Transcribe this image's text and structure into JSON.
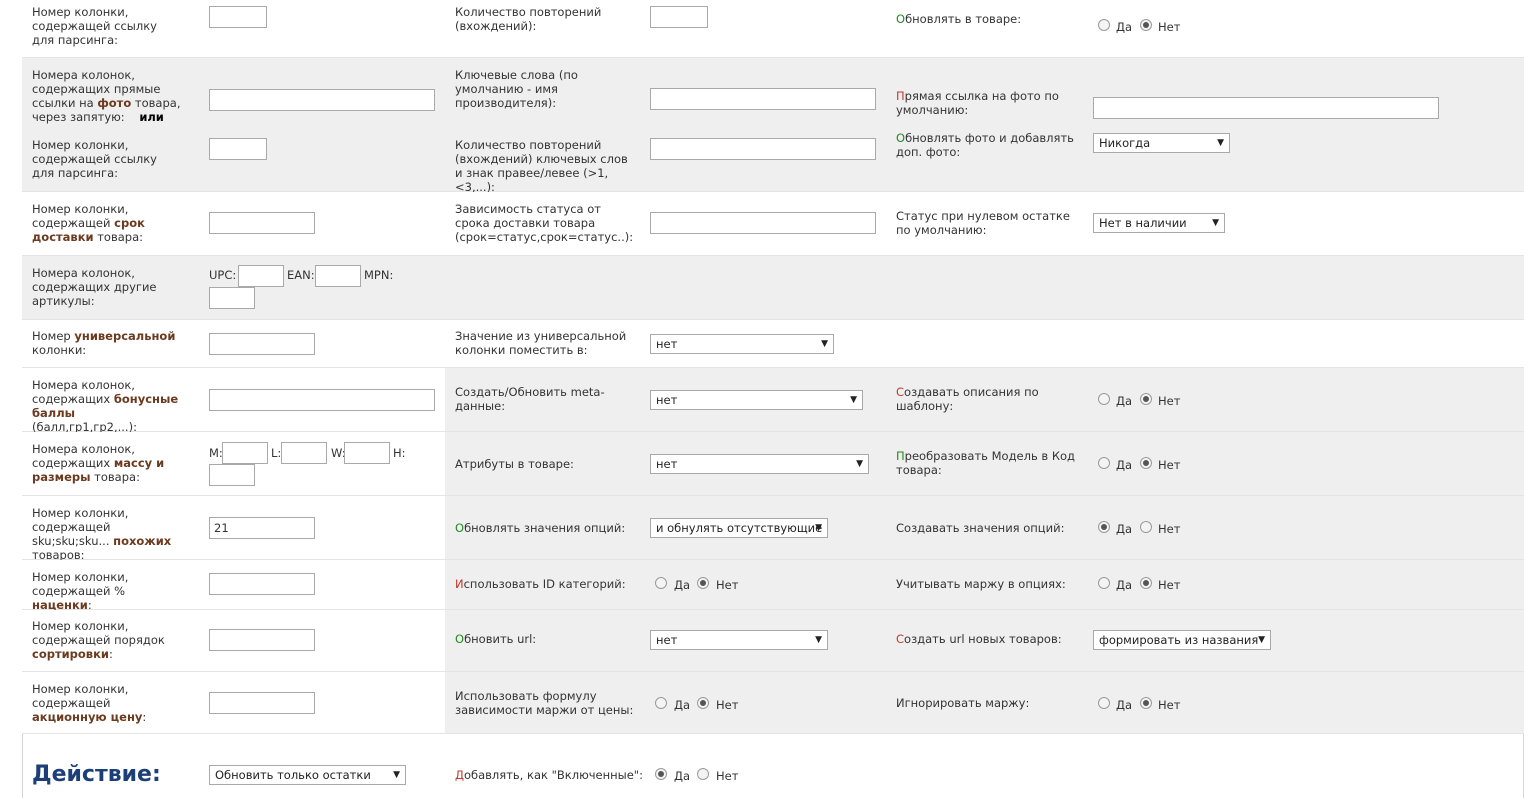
{
  "r1": {
    "c1_label": "Номер колонки, содержащей ссылку для парсинга:",
    "c2_label": "Количество повторений (вхождений):",
    "c3_first": "О",
    "c3_rest": "бновлять в товаре:",
    "yes": "Да",
    "no": "Нет"
  },
  "r2": {
    "c1_label_a": "Номера колонок, содержащих прямые ссылки на ",
    "c1_hl": "фото",
    "c1_label_b": " товара, через запятую:",
    "c1_or": "или",
    "c2_label": "Ключевые слова (по умолчанию - имя производителя):",
    "c3_first": "П",
    "c3_rest": "рямая ссылка на фото по умолчанию:",
    "c1b_label": "Номер колонки, содержащей ссылку для парсинга:",
    "c2b_label": "Количество повторений (вхождений) ключевых слов и знак правее/левее (>1,<3,...):",
    "c3b_first": "О",
    "c3b_rest": "бновлять фото и добавлять доп. фото:",
    "c3b_select": "Никогда"
  },
  "r3": {
    "c1_a": "Номер колонки, содержащей ",
    "c1_hl": "срок доставки",
    "c1_b": " товара:",
    "c2_label": "Зависимость статуса от срока доставки товара (срок=статус,срок=статус..):",
    "c3_label": "Статус при нулевом остатке по умолчанию:",
    "c3_select": "Нет в наличии"
  },
  "r4": {
    "c1_label": "Номера колонок, содержащих другие артикулы:",
    "upc": "UPC:",
    "ean": "EAN:",
    "mpn": "MPN:"
  },
  "r5": {
    "c1_a": "Номер ",
    "c1_hl": "универсальной",
    "c1_b": " колонки:",
    "c2_label": "Значение из универсальной колонки поместить в:",
    "c2_select": "нет"
  },
  "r6": {
    "c1_a": "Номера колонок, содержащих ",
    "c1_hl": "бонусные баллы",
    "c1_b": " (балл,гр1,гр2,...):",
    "c2_label": "Создать/Обновить meta-данные:",
    "c2_select": "нет",
    "c3_first": "С",
    "c3_rest": "оздавать описания по шаблону:"
  },
  "r7": {
    "c1_a": "Номера колонок, содержащих ",
    "c1_hl": "массу и размеры",
    "c1_b": " товара:",
    "m": "M:",
    "l": "L:",
    "w": "W:",
    "h": "H:",
    "c2_label": "Атрибуты в товаре:",
    "c2_select": "нет",
    "c3_first": "П",
    "c3_rest": "реобразовать Модель в Код товара:"
  },
  "r8": {
    "c1_a": "Номер колонки, содержащей sku;sku;sku... ",
    "c1_hl": "похожих",
    "c1_b": " товаров:",
    "c1_value": "21",
    "c2_first": "О",
    "c2_rest": "бновлять значения опций:",
    "c2_select": "и обнулять отсутствующие",
    "c3_label": "Создавать значения опций:"
  },
  "r9": {
    "c1_a": "Номер колонки, содержащей % ",
    "c1_hl": "наценки",
    "c1_b": ":",
    "c2_first": "И",
    "c2_rest": "спользовать ID категорий:",
    "c3_label": "Учитывать маржу в опциях:"
  },
  "r10": {
    "c1_a": "Номер колонки, содержащей порядок ",
    "c1_hl": "сортировки",
    "c1_b": ":",
    "c2_first": "О",
    "c2_rest": "бновить url:",
    "c2_select": "нет",
    "c3_first": "С",
    "c3_rest": "оздать url новых товаров:",
    "c3_select": "формировать из названия"
  },
  "r11": {
    "c1_a": "Номер колонки, содержащей ",
    "c1_hl": "акционную цену",
    "c1_b": ":",
    "c2_label": "Использовать формулу зависимости маржи от цены:",
    "c3_label": "Игнорировать маржу:"
  },
  "footer": {
    "action": "Действие:",
    "action_select": "Обновить только остатки",
    "add_first": "Д",
    "add_rest": "обавлять, как \"Включенные\":"
  },
  "colors": {
    "highlight": "#6b3a1f",
    "green": "#1f8a1f",
    "red": "#c0392b",
    "title": "#1d3f78",
    "row_gray": "#efefef"
  }
}
